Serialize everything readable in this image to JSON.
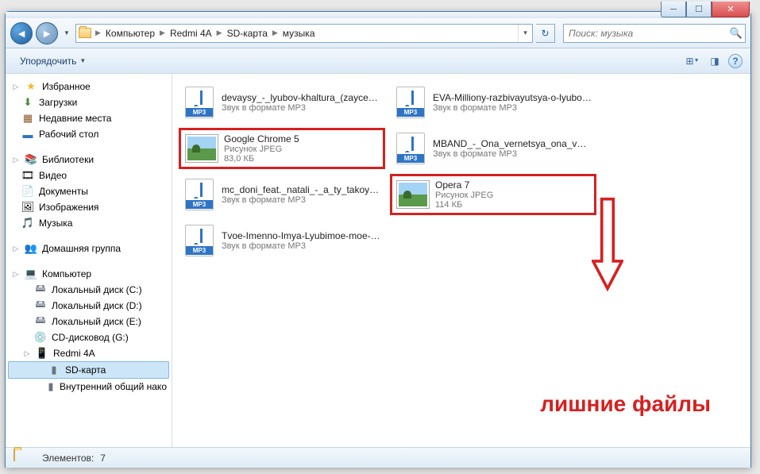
{
  "breadcrumbs": [
    "Компьютер",
    "Redmi 4A",
    "SD-карта",
    "музыка"
  ],
  "search_placeholder": "Поиск: музыка",
  "toolbar": {
    "organize": "Упорядочить"
  },
  "sidebar": {
    "favorites": {
      "label": "Избранное",
      "items": [
        "Загрузки",
        "Недавние места",
        "Рабочий стол"
      ]
    },
    "libraries": {
      "label": "Библиотеки",
      "items": [
        "Видео",
        "Документы",
        "Изображения",
        "Музыка"
      ]
    },
    "homegroup": {
      "label": "Домашняя группа"
    },
    "computer": {
      "label": "Компьютер",
      "items": [
        "Локальный диск (C:)",
        "Локальный диск (D:)",
        "Локальный диск (E:)",
        "CD-дисковод (G:)",
        "Redmi 4A"
      ],
      "sub": {
        "sd": "SD-карта",
        "internal": "Внутренний общий нако"
      }
    }
  },
  "files": [
    {
      "name": "devaysy_-_lyubov-khaltura_(zaycev.net)",
      "type": "Звук в формате MP3",
      "size": "",
      "kind": "mp3",
      "hl": false
    },
    {
      "name": "EVA-Milliony-razbivayutsya-o-lyubov_(muzofon.com)",
      "type": "Звук в формате MP3",
      "size": "",
      "kind": "mp3",
      "hl": false
    },
    {
      "name": "Google Chrome 5",
      "type": "Рисунок JPEG",
      "size": "83,0 КБ",
      "kind": "jpg",
      "hl": true
    },
    {
      "name": "MBAND_-_Ona_vernetsya_ona_vernet_sya_ona_uslyshit_ona_zaplac...",
      "type": "Звук в формате MP3",
      "size": "",
      "kind": "mp3",
      "hl": false
    },
    {
      "name": "mc_doni_feat._natali_-_a_ty_takoy_muzhchina_s_borodoy_(zaycev.net)",
      "type": "Звук в формате MP3",
      "size": "",
      "kind": "mp3",
      "hl": false
    },
    {
      "name": "Opera 7",
      "type": "Рисунок JPEG",
      "size": "114 КБ",
      "kind": "jpg",
      "hl": true
    },
    {
      "name": "Tvoe-Imenno-Imya-Lyubimoe-moe-i-nepobedimaya-Lyubov_-moya_(...",
      "type": "Звук в формате MP3",
      "size": "",
      "kind": "mp3",
      "hl": false
    }
  ],
  "status": {
    "label": "Элементов:",
    "count": "7"
  },
  "annotation": "лишние файлы"
}
